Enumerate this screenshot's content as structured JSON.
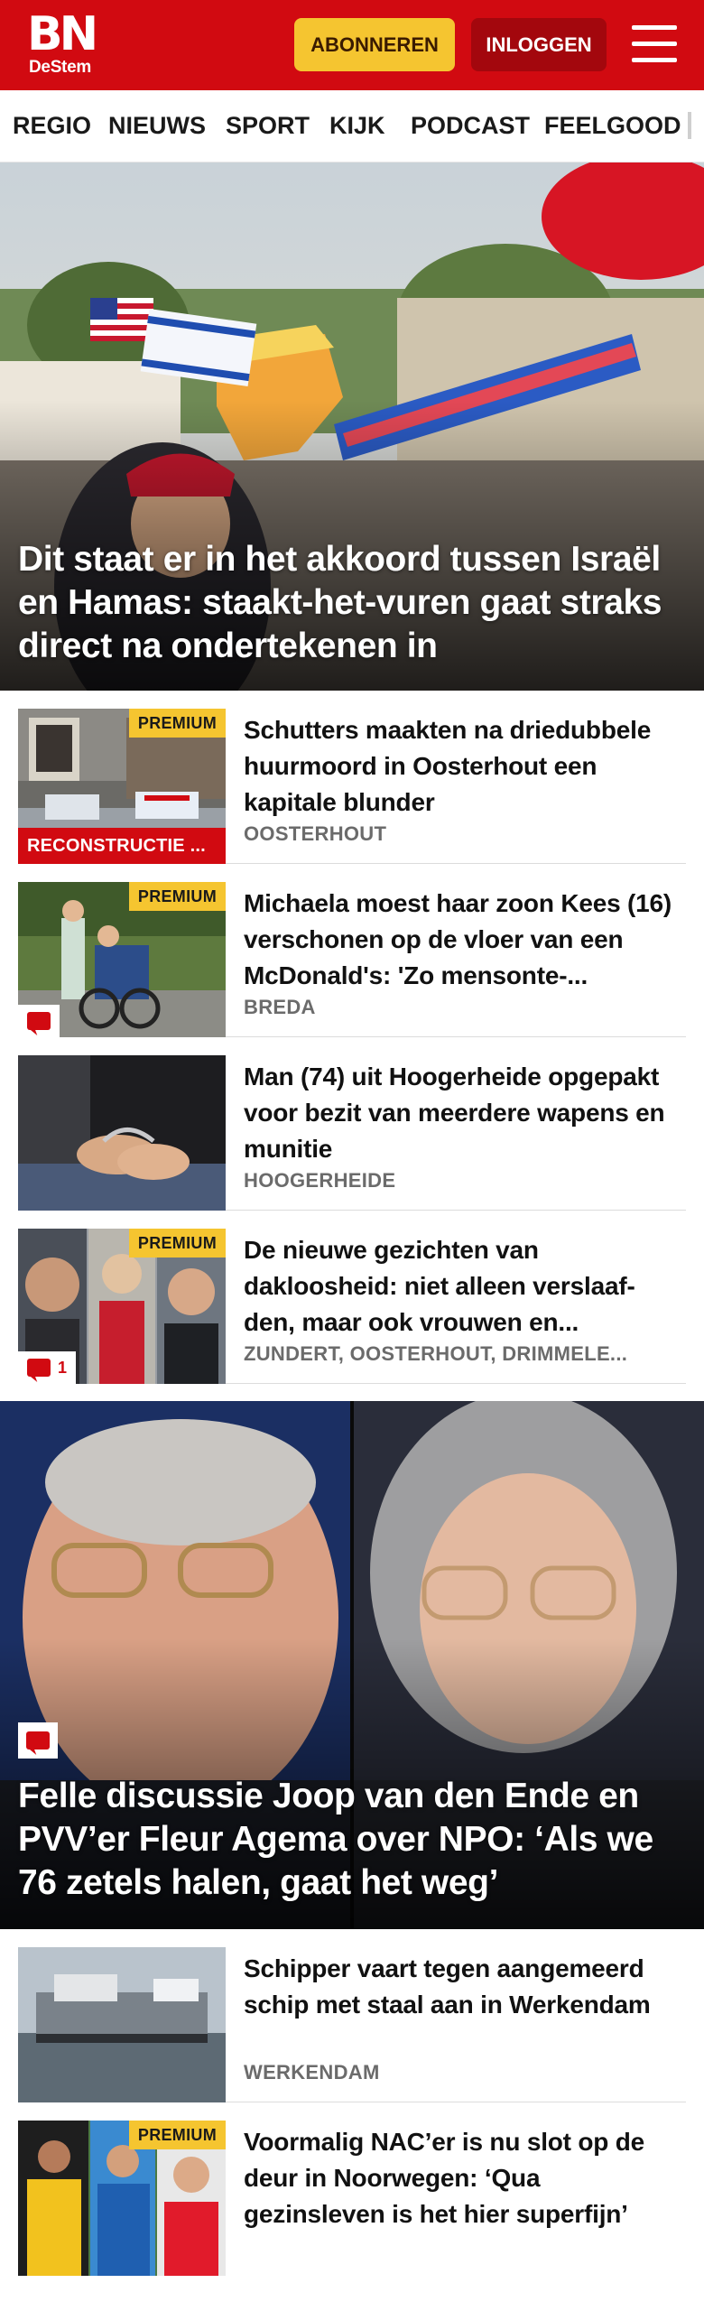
{
  "header": {
    "logo_main": "BN",
    "logo_sub": "DeStem",
    "subscribe_label": "ABONNEREN",
    "login_label": "INLOGGEN",
    "brand_color": "#d10a11",
    "accent_color": "#f5c530"
  },
  "nav": {
    "items": [
      "REGIO",
      "NIEUWS",
      "SPORT",
      "KIJK",
      "PODCAST",
      "FEELGOOD"
    ]
  },
  "hero": {
    "title": "Dit staat er in het akkoord tussen Israël en Hamas: staakt-het-vuren gaat straks direct na ondertekenen in"
  },
  "articles": [
    {
      "premium": "PREMIUM",
      "label": "RECONSTRUCTIE ...",
      "title": "Schutters maakten na driedubbele huurmoord in Oosterhout een kapitale blunder",
      "location": "OOSTERHOUT"
    },
    {
      "premium": "PREMIUM",
      "title": "Michaela moest haar zoon Kees (16) verschonen op de vloer van een McDonald's: 'Zo mensonte-...",
      "location": "BREDA"
    },
    {
      "title": "Man (74) uit Hoogerheide opgepakt voor bezit van meerdere wapens en munitie",
      "location": "HOOGERHEIDE"
    },
    {
      "premium": "PREMIUM",
      "comment_count": "1",
      "title": "De nieuwe gezichten van dakloosheid: niet alleen verslaaf-den, maar ook vrouwen en...",
      "location": "ZUNDERT, OOSTERHOUT, DRIMMELE..."
    }
  ],
  "hero2": {
    "title": "Felle discussie Joop van den Ende en PVV’er Fleur Agema over NPO: ‘Als we 76 zetels halen, gaat het weg’"
  },
  "articles2": [
    {
      "title": "Schipper vaart tegen aangemeerd schip met staal aan in Werkendam",
      "location": "WERKENDAM"
    },
    {
      "premium": "PREMIUM",
      "title": "Voormalig NAC’er is nu slot op de deur in Noorwegen: ‘Qua gezinsleven is het hier superfijn’"
    }
  ]
}
